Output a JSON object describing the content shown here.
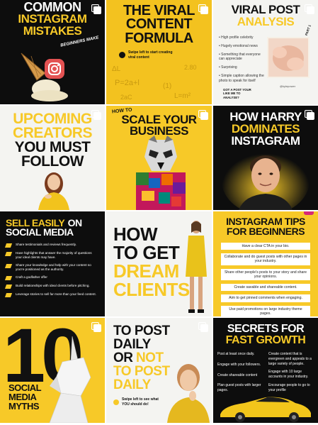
{
  "tiles": [
    {
      "title1": "COMMON",
      "title2": "INSTAGRAM",
      "title3": "MISTAKES",
      "sub": "BEGINNERS MAKE"
    },
    {
      "title1": "THE VIRAL",
      "title2": "CONTENT",
      "title3": "FORMULA",
      "swipe": "Swipe left to start creating viral content"
    },
    {
      "title1": "VIRAL POST",
      "title2": "ANALYSIS",
      "part": "PART 1",
      "bullets": [
        "High profile celebrity",
        "Hugely emotional news",
        "Something that everyone can appreciate",
        "Surprising",
        "Simple caption allowing the photo to speak for itself"
      ],
      "cta": "GOT A POST YOUR LIKE ME TO ANALYSE?",
      "handle": "@kylepower"
    },
    {
      "title1": "UPCOMING",
      "title2": "CREATORS",
      "title3": "YOU MUST",
      "title4": "FOLLOW"
    },
    {
      "title0": "HOW TO",
      "title1": "SCALE YOUR",
      "title2": "BUSINESS"
    },
    {
      "title1": "HOW HARRY",
      "title2": "DOMINATES",
      "title3": "INSTAGRAM"
    },
    {
      "title1": "SELL EASILY",
      "title1b": "ON",
      "title2": "SOCIAL MEDIA",
      "bullets": [
        "Share testimonials and reviews frequently.",
        "Have highlights that answer the majority of questions your ideal clients may have.",
        "Share your knowledge and help with your content so you're positioned as the authority.",
        "Craft a godfather offer",
        "Build relationships with ideal clients before pitching.",
        "Leverage stories to sell far more than your feed content."
      ]
    },
    {
      "title1": "HOW",
      "title2": "TO GET",
      "title3": "DREAM",
      "title4": "CLIENTS"
    },
    {
      "title1": "INSTAGRAM TIPS",
      "title2": "FOR BEGINNERS",
      "tips": [
        "Have a clear CTA in your bio.",
        "Collaborate and do guest posts with other pages in your industry.",
        "Share other people's posts to your story and share your opinions.",
        "Create savable and shareable content.",
        "Aim to get pinned comments when engaging.",
        "Use paid promotions on large industry theme pages."
      ]
    },
    {
      "title0": "10",
      "title1": "SOCIAL",
      "title2": "MEDIA",
      "title3": "MYTHS"
    },
    {
      "title1": "TO POST",
      "title2": "DAILY",
      "title3": "OR",
      "title4": "NOT",
      "title5": "TO POST",
      "title6": "DAILY",
      "swipe": "Swipe left to see what YOU should do!"
    },
    {
      "title1": "SECRETS FOR",
      "title2": "FAST GROWTH",
      "col1": [
        "Post at least once daily.",
        "Engage with your followers.",
        "Create shareable content",
        "Plan guest posts with larger pages."
      ],
      "col2": [
        "Create content that is evergreen and appeals to a large variety of people.",
        "Engage with 10 large accounts in your industry.",
        "Encourage people to go to your profile"
      ]
    }
  ],
  "colors": {
    "accent": "#f7c928",
    "dark": "#0d0d0d",
    "light": "#f4f4f1"
  }
}
